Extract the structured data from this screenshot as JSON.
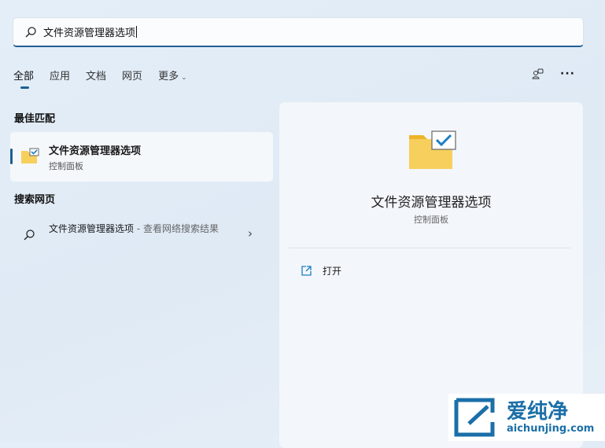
{
  "search": {
    "value": "文件资源管理器选项"
  },
  "tabs": [
    {
      "label": "全部"
    },
    {
      "label": "应用"
    },
    {
      "label": "文档"
    },
    {
      "label": "网页"
    },
    {
      "label": "更多"
    }
  ],
  "best_match": {
    "heading": "最佳匹配",
    "title": "文件资源管理器选项",
    "subtitle": "控制面板"
  },
  "web_search": {
    "heading": "搜索网页",
    "title": "文件资源管理器选项",
    "suffix": " - 查看网络搜索结果"
  },
  "detail": {
    "title": "文件资源管理器选项",
    "subtitle": "控制面板",
    "actions": [
      {
        "label": "打开"
      }
    ]
  },
  "watermark": {
    "name": "爱纯净",
    "url": "aichunjing.com"
  },
  "colors": {
    "accent": "#1f5f92"
  }
}
